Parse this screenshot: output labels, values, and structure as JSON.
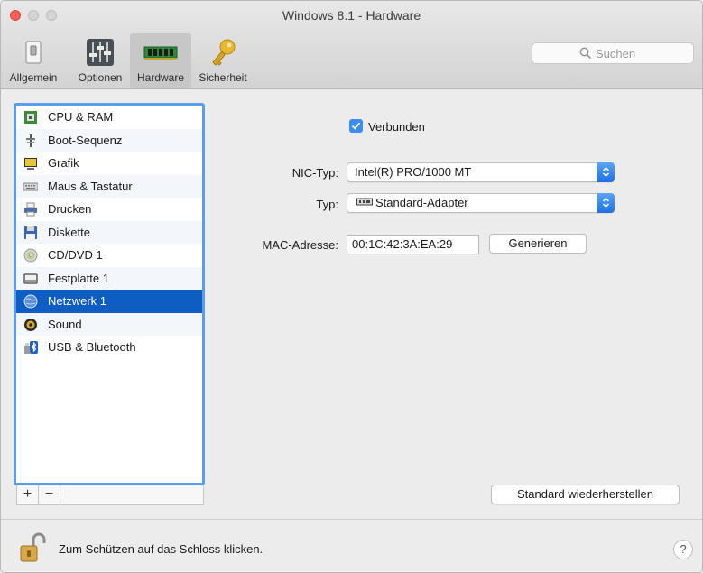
{
  "window": {
    "title": "Windows 8.1 - Hardware"
  },
  "toolbar": {
    "tabs": [
      {
        "label": "Allgemein",
        "icon": "switch-icon"
      },
      {
        "label": "Optionen",
        "icon": "sliders-icon"
      },
      {
        "label": "Hardware",
        "icon": "memory-chip-icon",
        "active": true
      },
      {
        "label": "Sicherheit",
        "icon": "key-icon"
      }
    ],
    "search_placeholder": "Suchen"
  },
  "sidebar": {
    "items": [
      {
        "label": "CPU & RAM",
        "icon": "cpu-icon"
      },
      {
        "label": "Boot-Sequenz",
        "icon": "boot-icon"
      },
      {
        "label": "Grafik",
        "icon": "monitor-icon"
      },
      {
        "label": "Maus & Tastatur",
        "icon": "keyboard-icon"
      },
      {
        "label": "Drucken",
        "icon": "printer-icon"
      },
      {
        "label": "Diskette",
        "icon": "floppy-icon"
      },
      {
        "label": "CD/DVD 1",
        "icon": "disc-icon"
      },
      {
        "label": "Festplatte 1",
        "icon": "hard-disk-icon"
      },
      {
        "label": "Netzwerk 1",
        "icon": "network-globe-icon",
        "selected": true
      },
      {
        "label": "Sound",
        "icon": "speaker-icon"
      },
      {
        "label": "USB & Bluetooth",
        "icon": "usb-bluetooth-icon"
      }
    ],
    "add_label": "+",
    "remove_label": "−"
  },
  "network": {
    "connected_label": "Verbunden",
    "connected": true,
    "nic_label": "NIC-Typ:",
    "nic_value": "Intel(R) PRO/1000 MT",
    "type_label": "Typ:",
    "type_value": "Standard-Adapter",
    "mac_label": "MAC-Adresse:",
    "mac_value": "00:1C:42:3A:EA:29",
    "generate_label": "Generieren",
    "restore_label": "Standard wiederherstellen"
  },
  "footer": {
    "lock_text": "Zum Schützen auf das Schloss klicken.",
    "help_label": "?"
  },
  "colors": {
    "accent": "#0d5dc3",
    "focus_ring": "#5a9ced",
    "close_button": "#fd5f57"
  }
}
